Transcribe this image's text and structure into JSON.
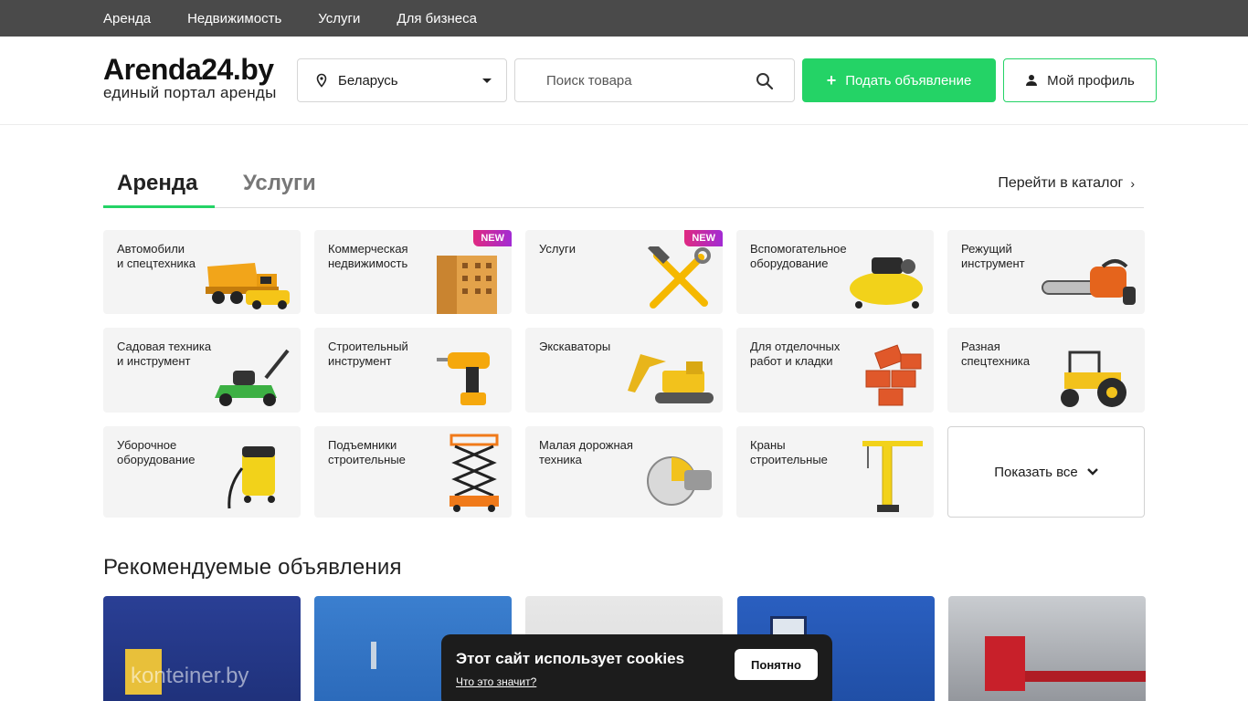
{
  "topnav": {
    "items": [
      "Аренда",
      "Недвижимость",
      "Услуги",
      "Для бизнеса"
    ]
  },
  "header": {
    "logo_title": "Arenda24.by",
    "logo_subtitle": "единый портал аренды",
    "region": "Беларусь",
    "search_placeholder": "Поиск товара",
    "post_button": "Подать объявление",
    "profile_button": "Мой профиль"
  },
  "tabs": {
    "items": [
      "Аренда",
      "Услуги"
    ],
    "active": "Аренда",
    "catalog_link": "Перейти в каталог"
  },
  "categories": [
    {
      "label": "Автомобили\nи спецтехника",
      "badge": "",
      "icon": "dump-truck-icon"
    },
    {
      "label": "Коммерческая\nнедвижимость",
      "badge": "NEW",
      "icon": "building-icon"
    },
    {
      "label": "Услуги",
      "badge": "NEW",
      "icon": "hammer-wrench-icon"
    },
    {
      "label": "Вспомогательное\nоборудование",
      "badge": "",
      "icon": "compressor-icon"
    },
    {
      "label": "Режущий\nинструмент",
      "badge": "",
      "icon": "chainsaw-icon"
    },
    {
      "label": "Садовая техника\nи инструмент",
      "badge": "",
      "icon": "lawnmower-icon"
    },
    {
      "label": "Строительный\nинструмент",
      "badge": "",
      "icon": "drill-icon"
    },
    {
      "label": "Экскаваторы",
      "badge": "",
      "icon": "excavator-icon"
    },
    {
      "label": "Для отделочных\nработ и кладки",
      "badge": "",
      "icon": "bricks-icon"
    },
    {
      "label": "Разная\nспецтехника",
      "badge": "",
      "icon": "tractor-icon"
    },
    {
      "label": "Уборочное\nоборудование",
      "badge": "",
      "icon": "vacuum-icon"
    },
    {
      "label": "Подъемники\nстроительные",
      "badge": "",
      "icon": "scissor-lift-icon"
    },
    {
      "label": "Малая дорожная\nтехника",
      "badge": "",
      "icon": "road-saw-icon"
    },
    {
      "label": "Краны\nстроительные",
      "badge": "",
      "icon": "crane-icon"
    }
  ],
  "show_all": "Показать все",
  "recommended": {
    "title": "Рекомендуемые объявления",
    "watermark": "konteiner.by"
  },
  "cookie": {
    "title": "Этот сайт использует cookies",
    "link": "Что это значит?",
    "button": "Понятно"
  },
  "colors": {
    "accent": "#24d366",
    "topbar": "#4a4a4a",
    "badge": "#d62a96"
  }
}
